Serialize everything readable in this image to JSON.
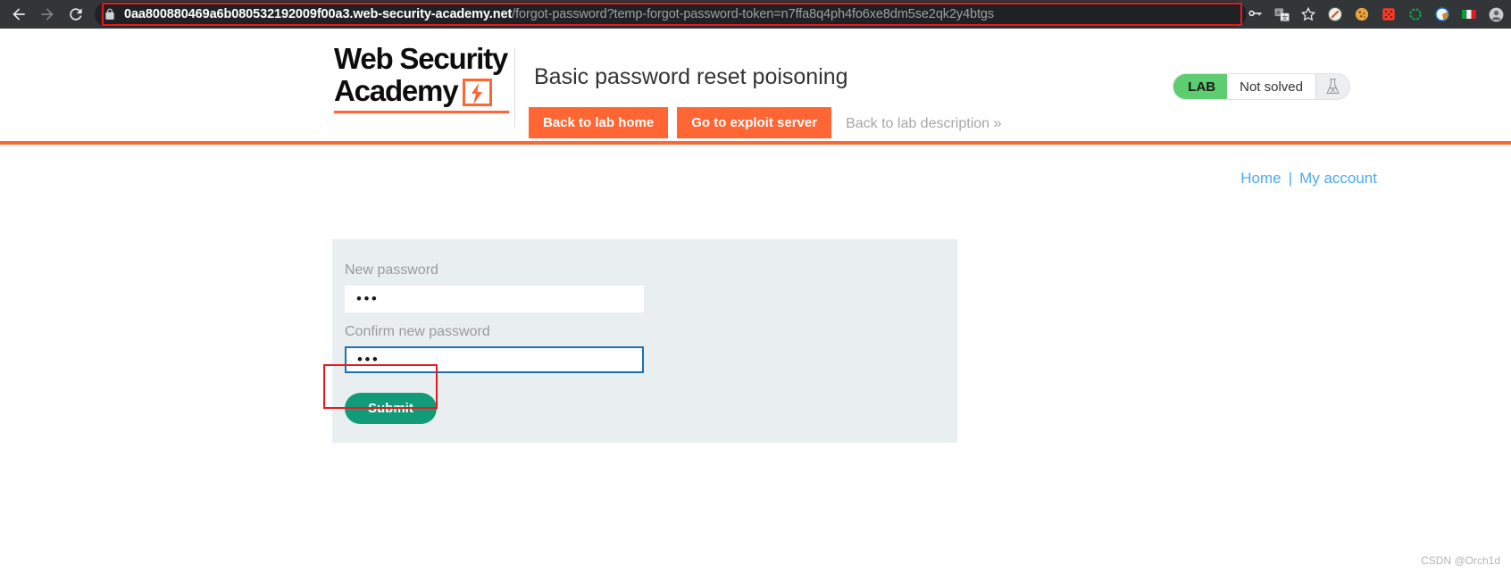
{
  "browser": {
    "nav": {
      "back_label": "Back",
      "forward_label": "Forward",
      "reload_label": "Reload"
    },
    "omnibox": {
      "lock_icon": "lock-icon",
      "url_domain": "0aa800880469a6b080532192009f00a3.web-security-academy.net",
      "url_path": "/forgot-password?temp-forgot-password-token=n7ffa8q4ph4fo6xe8dm5se2qk2y4btgs",
      "full_url": "0aa800880469a6b080532192009f00a3.web-security-academy.net/forgot-password?temp-forgot-password-token=n7ffa8q4ph4fo6xe8dm5se2qk2y4btgs"
    },
    "toolbar_icons": [
      {
        "name": "password-manager-key-icon",
        "glyph": "key"
      },
      {
        "name": "translate-icon",
        "glyph": "translate"
      },
      {
        "name": "bookmark-star-icon",
        "glyph": "star"
      },
      {
        "name": "adblock-extension-icon",
        "glyph": "adblock"
      },
      {
        "name": "cookie-editor-extension-icon",
        "glyph": "cookie"
      },
      {
        "name": "dice-extension-icon",
        "glyph": "dice"
      },
      {
        "name": "wappalyzer-extension-icon",
        "glyph": "gear-ring"
      },
      {
        "name": "proxy-switch-extension-icon",
        "glyph": "proxy"
      },
      {
        "name": "flag-extension-icon",
        "glyph": "flag-italy"
      },
      {
        "name": "profile-avatar-icon",
        "glyph": "avatar"
      }
    ]
  },
  "header": {
    "logo_line1": "Web Security",
    "logo_line2": "Academy",
    "logo_bolt_icon": "lightning-bolt-icon",
    "lab_title": "Basic password reset poisoning",
    "buttons": {
      "back_to_lab_home": "Back to lab home",
      "go_to_exploit_server": "Go to exploit server",
      "back_to_lab_description": "Back to lab description",
      "chevron": "»"
    },
    "status": {
      "badge": "LAB",
      "state": "Not solved",
      "flask_icon": "flask-icon"
    },
    "colors": {
      "accent_orange": "#ff6633",
      "status_green": "#5ecc70",
      "submit_teal": "#119b79",
      "link_blue": "#4daaf5",
      "annotation_red": "#e8191b"
    }
  },
  "content": {
    "account_nav": {
      "home": "Home",
      "separator": "|",
      "my_account": "My account"
    },
    "form": {
      "new_password_label": "New password",
      "new_password_value": "•••",
      "confirm_password_label": "Confirm new password",
      "confirm_password_value": "•••",
      "submit_label": "Submit"
    }
  },
  "watermark": "CSDN @Orch1d"
}
